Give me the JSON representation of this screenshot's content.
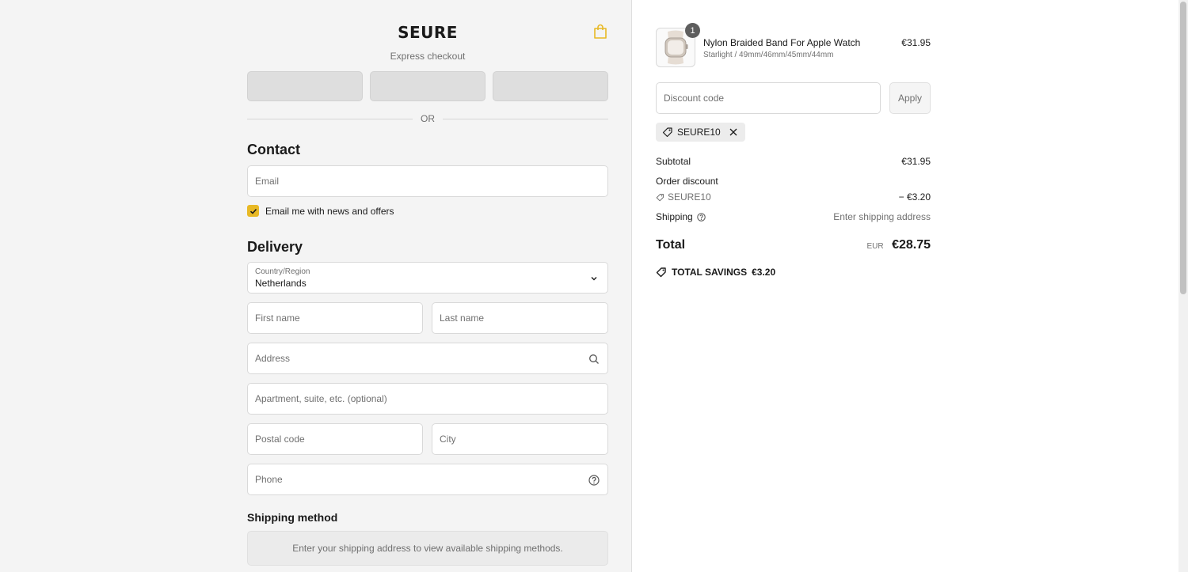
{
  "header": {
    "brand": "SEURE",
    "cart_icon": "shopping-bag-icon"
  },
  "express": {
    "label": "Express checkout",
    "buttons": [
      "",
      "",
      ""
    ],
    "divider": "OR"
  },
  "contact": {
    "heading": "Contact",
    "email_placeholder": "Email",
    "newsletter_label": "Email me with news and offers",
    "newsletter_checked": true
  },
  "delivery": {
    "heading": "Delivery",
    "country_label": "Country/Region",
    "country_value": "Netherlands",
    "first_name_placeholder": "First name",
    "last_name_placeholder": "Last name",
    "address_placeholder": "Address",
    "apartment_placeholder": "Apartment, suite, etc. (optional)",
    "postal_placeholder": "Postal code",
    "city_placeholder": "City",
    "phone_placeholder": "Phone"
  },
  "shipping_method": {
    "heading": "Shipping method",
    "notice": "Enter your shipping address to view available shipping methods."
  },
  "summary": {
    "product": {
      "quantity": "1",
      "name": "Nylon Braided Band For Apple Watch",
      "variant": "Starlight / 49mm/46mm/45mm/44mm",
      "price": "€31.95"
    },
    "discount_placeholder": "Discount code",
    "apply_label": "Apply",
    "applied_code": "SEURE10",
    "subtotal_label": "Subtotal",
    "subtotal_value": "€31.95",
    "order_discount_label": "Order discount",
    "discount_code": "SEURE10",
    "discount_value": "− €3.20",
    "shipping_label": "Shipping",
    "shipping_value": "Enter shipping address",
    "total_label": "Total",
    "total_currency": "EUR",
    "total_value": "€28.75",
    "savings_label": "TOTAL SAVINGS",
    "savings_value": "€3.20"
  },
  "colors": {
    "accent": "#e8b925",
    "page_bg": "#f4f4f4",
    "panel_bg": "#ffffff"
  }
}
